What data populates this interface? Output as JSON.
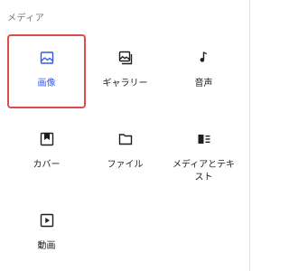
{
  "section": {
    "title": "メディア"
  },
  "blocks": [
    {
      "label": "画像",
      "icon": "image-icon",
      "selected": true
    },
    {
      "label": "ギャラリー",
      "icon": "gallery-icon",
      "selected": false
    },
    {
      "label": "音声",
      "icon": "audio-icon",
      "selected": false
    },
    {
      "label": "カバー",
      "icon": "cover-icon",
      "selected": false
    },
    {
      "label": "ファイル",
      "icon": "file-icon",
      "selected": false
    },
    {
      "label": "メディアとテキスト",
      "icon": "media-text-icon",
      "selected": false
    },
    {
      "label": "動画",
      "icon": "video-icon",
      "selected": false
    }
  ],
  "colors": {
    "accent": "#3858e9",
    "selection_border": "#e24b4b",
    "text": "#1e1e1e",
    "muted": "#757575"
  }
}
